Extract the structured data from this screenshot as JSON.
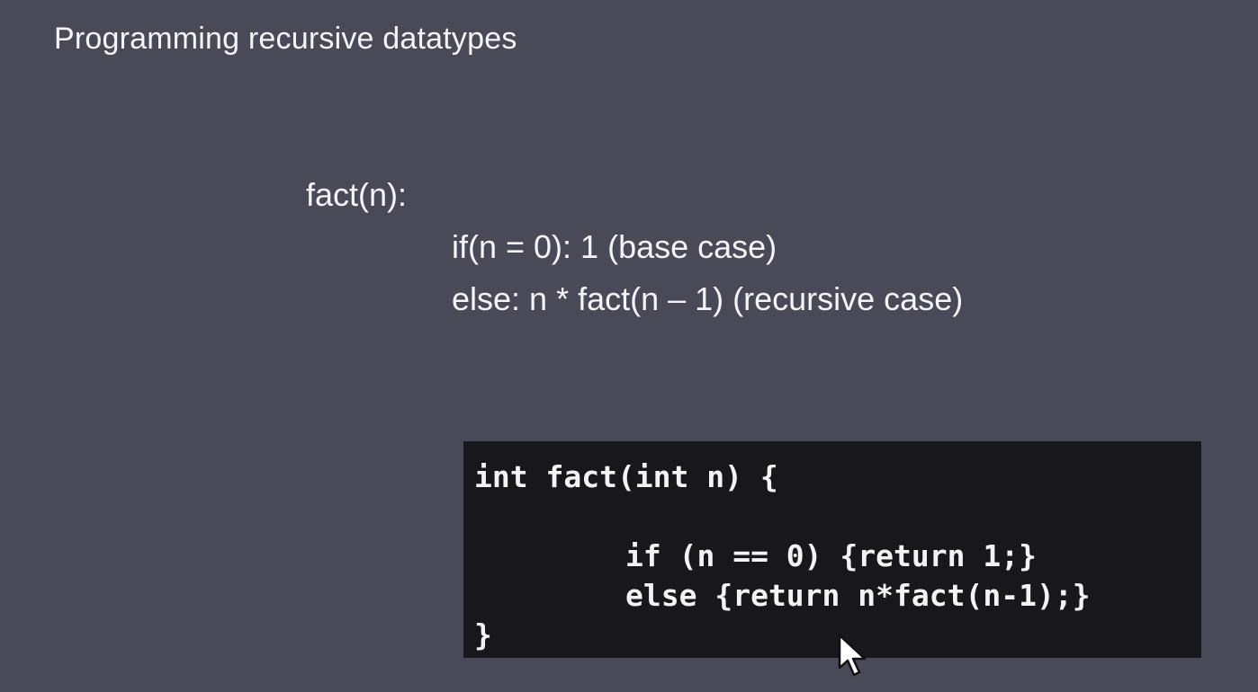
{
  "slide": {
    "title": "Programming recursive datatypes",
    "pseudocode": {
      "signature": "fact(n):",
      "base_line": "if(n = 0): 1 (base case)",
      "recursive_line": "else: n * fact(n – 1) (recursive case)"
    },
    "code": {
      "line1": "int fact(int n) {",
      "line2": "if (n == 0) {return 1;}",
      "line3": "else {return n*fact(n-1);}",
      "line4": "}"
    }
  },
  "colors": {
    "background": "#4a4958",
    "code_background": "#18171b",
    "text": "#f4f4f7"
  },
  "icons": {
    "cursor": "mouse-pointer-icon"
  }
}
